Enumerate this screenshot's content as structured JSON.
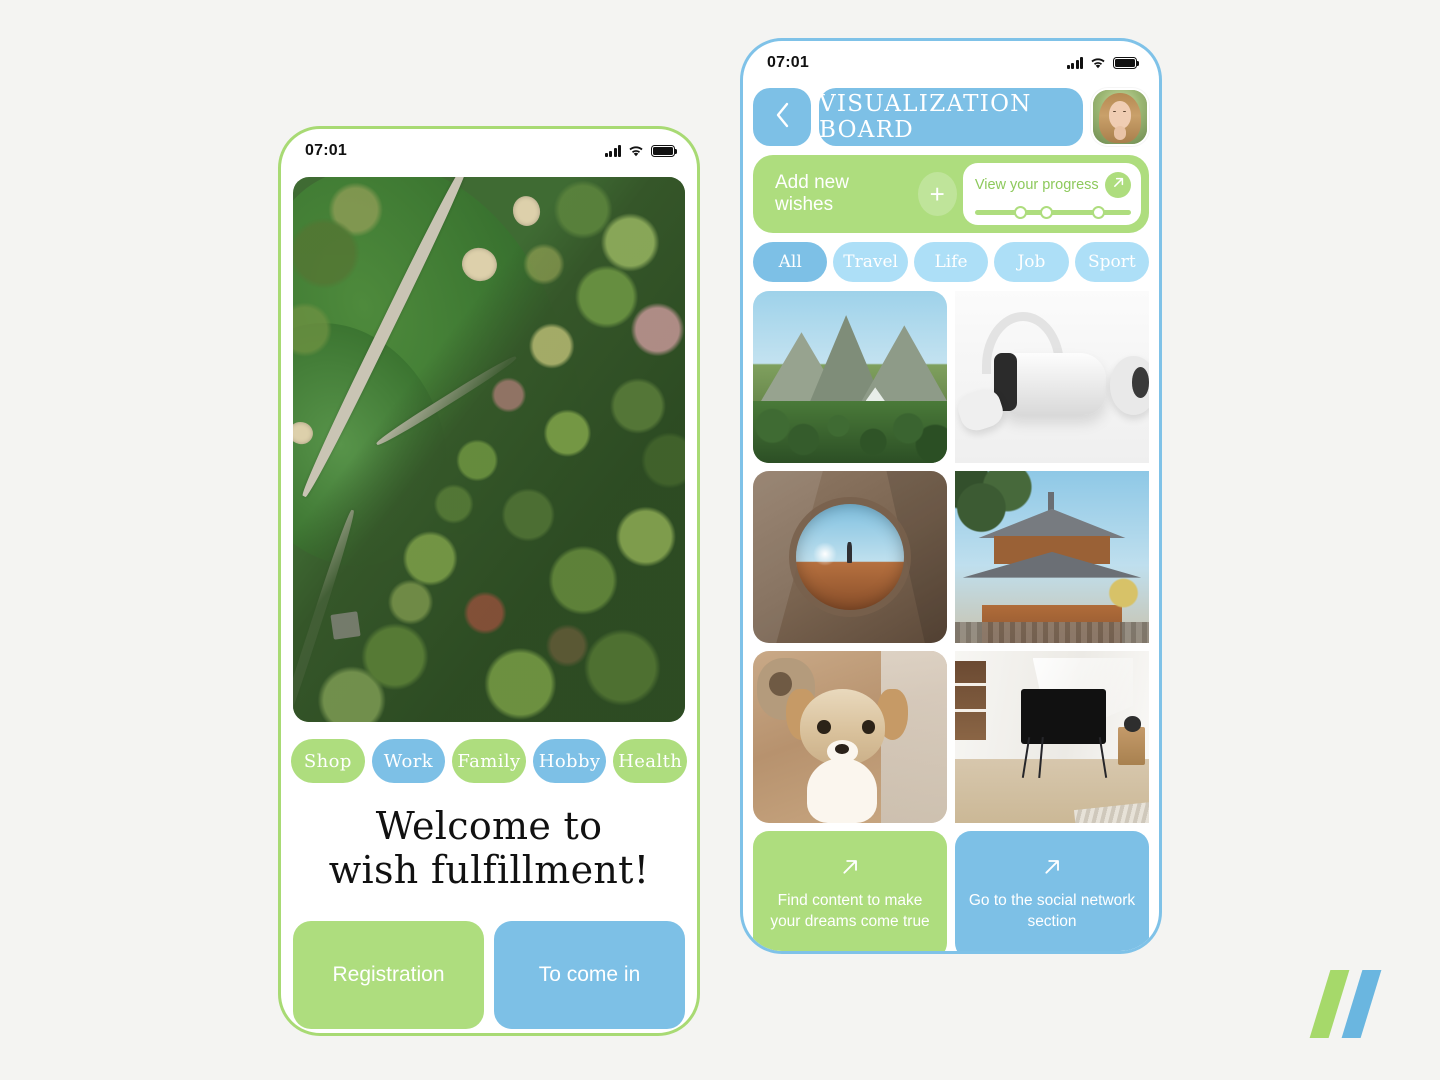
{
  "canvas": {
    "background": "#f4f4f2"
  },
  "brand": {
    "logo_name": "double-slash-logo",
    "green": "#a6d96a",
    "blue": "#6ab6e0"
  },
  "left_phone": {
    "border_color": "#a8da74",
    "status": {
      "time": "07:01",
      "signal_icon": "signal-bars-icon",
      "wifi_icon": "wifi-icon",
      "battery_icon": "battery-full-icon"
    },
    "hero_image_alt": "aerial view of golf course and autumn forest",
    "category_pills": [
      {
        "label": "Shop",
        "color": "green"
      },
      {
        "label": "Work",
        "color": "blue"
      },
      {
        "label": "Family",
        "color": "green"
      },
      {
        "label": "Hobby",
        "color": "blue"
      },
      {
        "label": "Health",
        "color": "green"
      }
    ],
    "welcome_line1": "Welcome to",
    "welcome_line2": "wish fulfillment!",
    "buttons": {
      "registration": "Registration",
      "sign_in": "To come in"
    }
  },
  "right_phone": {
    "border_color": "#7fc2e8",
    "status": {
      "time": "07:01",
      "signal_icon": "signal-bars-icon",
      "wifi_icon": "wifi-icon",
      "battery_icon": "battery-full-icon"
    },
    "header": {
      "back_icon": "chevron-left-icon",
      "title": "VISUALIZATION BOARD",
      "avatar_alt": "user profile photo"
    },
    "add_panel": {
      "add_label": "Add new wishes",
      "plus_icon": "plus-icon",
      "progress_label": "View your progress",
      "progress_arrow_icon": "arrow-up-right-icon",
      "progress_nodes": [
        25,
        42,
        75
      ]
    },
    "filter_chips": [
      {
        "label": "All",
        "active": true
      },
      {
        "label": "Travel",
        "active": false
      },
      {
        "label": "Life",
        "active": false
      },
      {
        "label": "Job",
        "active": false
      },
      {
        "label": "Sport",
        "active": false
      }
    ],
    "board_tiles": [
      {
        "alt": "mountain range with forest"
      },
      {
        "alt": "white VR headset with controllers"
      },
      {
        "alt": "view through tent opening of person on dune"
      },
      {
        "alt": "japanese temple with pine trees"
      },
      {
        "alt": "fluffy puppy on bed"
      },
      {
        "alt": "flat tv on stand in sunlit room"
      }
    ],
    "bottom_cards": [
      {
        "icon": "arrow-up-right-icon",
        "text": "Find content to make your dreams come true",
        "color": "green"
      },
      {
        "icon": "arrow-up-right-icon",
        "text": "Go to the social network section",
        "color": "blue"
      }
    ]
  }
}
